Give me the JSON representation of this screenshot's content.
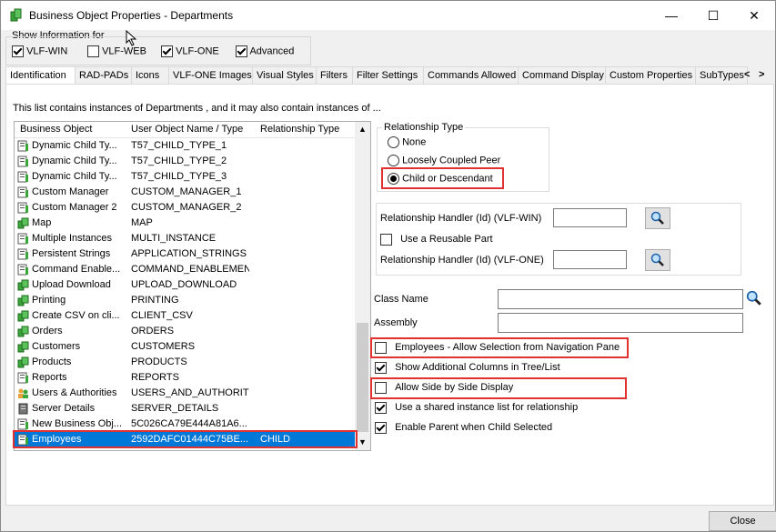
{
  "window": {
    "title": "Business Object Properties - Departments",
    "minimize": "—",
    "maximize": "☐",
    "close": "✕"
  },
  "show_info": {
    "label": "Show Information for",
    "options": [
      {
        "label": "VLF-WIN",
        "checked": true
      },
      {
        "label": "VLF-WEB",
        "checked": false
      },
      {
        "label": "VLF-ONE",
        "checked": true
      },
      {
        "label": "Advanced",
        "checked": true
      }
    ]
  },
  "tabs": [
    "Identification",
    "RAD-PADs",
    "Icons",
    "VLF-ONE Images",
    "Visual Styles",
    "Filters",
    "Filter Settings",
    "Commands Allowed",
    "Command Display",
    "Custom Properties",
    "SubTypes"
  ],
  "tab_scroll": {
    "left": "<",
    "right": ">"
  },
  "info_text": "This list contains instances of Departments , and it may also contain instances of ...",
  "list": {
    "headers": [
      "Business Object",
      "User Object Name / Type",
      "Relationship Type"
    ],
    "rows": [
      {
        "name": "Dynamic Child Ty...",
        "type": "T57_CHILD_TYPE_1",
        "rel": "",
        "icon": "doc"
      },
      {
        "name": "Dynamic Child Ty...",
        "type": "T57_CHILD_TYPE_2",
        "rel": "",
        "icon": "doc"
      },
      {
        "name": "Dynamic Child Ty...",
        "type": "T57_CHILD_TYPE_3",
        "rel": "",
        "icon": "doc"
      },
      {
        "name": "Custom Manager",
        "type": "CUSTOM_MANAGER_1",
        "rel": "",
        "icon": "doc"
      },
      {
        "name": "Custom Manager 2",
        "type": "CUSTOM_MANAGER_2",
        "rel": "",
        "icon": "doc"
      },
      {
        "name": "Map",
        "type": "MAP",
        "rel": "",
        "icon": "green"
      },
      {
        "name": "Multiple Instances",
        "type": "MULTI_INSTANCE",
        "rel": "",
        "icon": "doc"
      },
      {
        "name": "Persistent Strings",
        "type": "APPLICATION_STRINGS",
        "rel": "",
        "icon": "doc"
      },
      {
        "name": "Command Enable...",
        "type": "COMMAND_ENABLEMENT",
        "rel": "",
        "icon": "doc"
      },
      {
        "name": "Upload Download",
        "type": "UPLOAD_DOWNLOAD",
        "rel": "",
        "icon": "green"
      },
      {
        "name": "Printing",
        "type": "PRINTING",
        "rel": "",
        "icon": "green"
      },
      {
        "name": "Create CSV on cli...",
        "type": "CLIENT_CSV",
        "rel": "",
        "icon": "green"
      },
      {
        "name": "Orders",
        "type": "ORDERS",
        "rel": "",
        "icon": "green"
      },
      {
        "name": "Customers",
        "type": "CUSTOMERS",
        "rel": "",
        "icon": "green"
      },
      {
        "name": "Products",
        "type": "PRODUCTS",
        "rel": "",
        "icon": "green"
      },
      {
        "name": "Reports",
        "type": "REPORTS",
        "rel": "",
        "icon": "doc"
      },
      {
        "name": "Users & Authorities",
        "type": "USERS_AND_AUTHORITY",
        "rel": "",
        "icon": "users"
      },
      {
        "name": "Server Details",
        "type": "SERVER_DETAILS",
        "rel": "",
        "icon": "server"
      },
      {
        "name": "New Business Obj...",
        "type": "5C026CA79E444A81A6...",
        "rel": "",
        "icon": "doc"
      },
      {
        "name": "Employees",
        "type": "2592DAFC01444C75BE...",
        "rel": "CHILD",
        "icon": "doc",
        "selected": true
      }
    ]
  },
  "relationship": {
    "legend": "Relationship Type",
    "options": [
      {
        "label": "None",
        "selected": false
      },
      {
        "label": "Loosely Coupled Peer",
        "selected": false
      },
      {
        "label": "Child or Descendant",
        "selected": true
      }
    ]
  },
  "handler": {
    "win_label": "Relationship Handler (Id) (VLF-WIN)",
    "reusable_label": "Use a Reusable Part",
    "one_label": "Relationship Handler (Id) (VLF-ONE)"
  },
  "class_name_label": "Class Name",
  "assembly_label": "Assembly",
  "checks": [
    {
      "label": "Employees - Allow Selection from Navigation Pane",
      "checked": false
    },
    {
      "label": "Show Additional Columns in Tree/List",
      "checked": true
    },
    {
      "label": "Allow Side by Side Display",
      "checked": false
    },
    {
      "label": "Use a shared instance list for relationship",
      "checked": true
    },
    {
      "label": "Enable Parent when Child Selected",
      "checked": true
    }
  ],
  "close_button": "Close",
  "colors": {
    "selection": "#0078d7",
    "highlight": "#e03030",
    "green_icon": "#3aa63a"
  }
}
